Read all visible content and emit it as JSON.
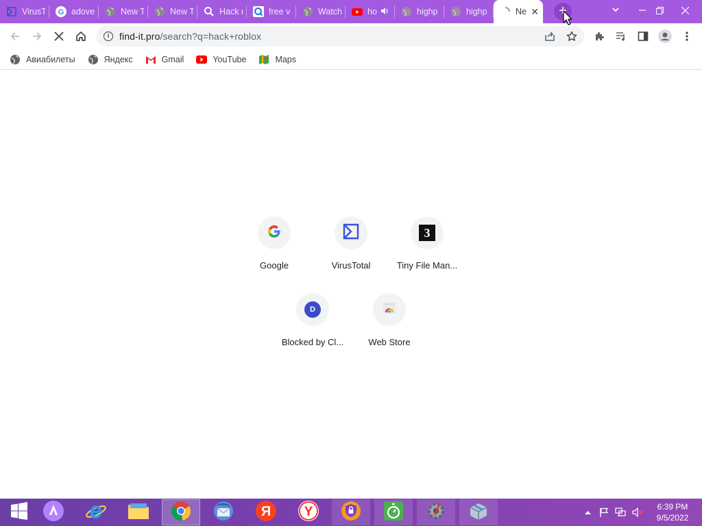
{
  "tabs": [
    {
      "title": "VirusT",
      "icon": "virustotal-icon"
    },
    {
      "title": "adove",
      "icon": "google-icon"
    },
    {
      "title": "New T",
      "icon": "globe-icon"
    },
    {
      "title": "New T",
      "icon": "globe-icon"
    },
    {
      "title": "Hack r",
      "icon": "search-icon"
    },
    {
      "title": "free v",
      "icon": "magnifier-icon"
    },
    {
      "title": "Watch",
      "icon": "globe-icon"
    },
    {
      "title": "ho",
      "icon": "youtube-icon",
      "audio": true
    },
    {
      "title": "highp",
      "icon": "globe-icon"
    },
    {
      "title": "highp",
      "icon": "globe-icon"
    },
    {
      "title": "Ne",
      "icon": "loading-icon",
      "active": true
    }
  ],
  "omnibox": {
    "host": "find-it.pro",
    "path": "/search?q=hack+roblox"
  },
  "bookmarks": [
    {
      "label": "Авиабилеты",
      "icon": "globe-icon"
    },
    {
      "label": "Яндекс",
      "icon": "globe-icon"
    },
    {
      "label": "Gmail",
      "icon": "gmail-icon"
    },
    {
      "label": "YouTube",
      "icon": "youtube-icon"
    },
    {
      "label": "Maps",
      "icon": "maps-icon"
    }
  ],
  "shortcuts": [
    {
      "label": "Google",
      "icon": "google-icon"
    },
    {
      "label": "VirusTotal",
      "icon": "virustotal-icon"
    },
    {
      "label": "Tiny File Man...",
      "icon": "tiny-file-manager-icon",
      "glyph": "3"
    },
    {
      "label": "Blocked by Cl...",
      "icon": "letter-d-icon",
      "glyph": "D"
    },
    {
      "label": "Web Store",
      "icon": "web-store-icon"
    }
  ],
  "clock": {
    "time": "6:39 PM",
    "date": "9/5/2022"
  },
  "colors": {
    "tabstrip": "#a35ae0",
    "accent": "#1a73e8",
    "taskbar": "#7b3fb0"
  }
}
